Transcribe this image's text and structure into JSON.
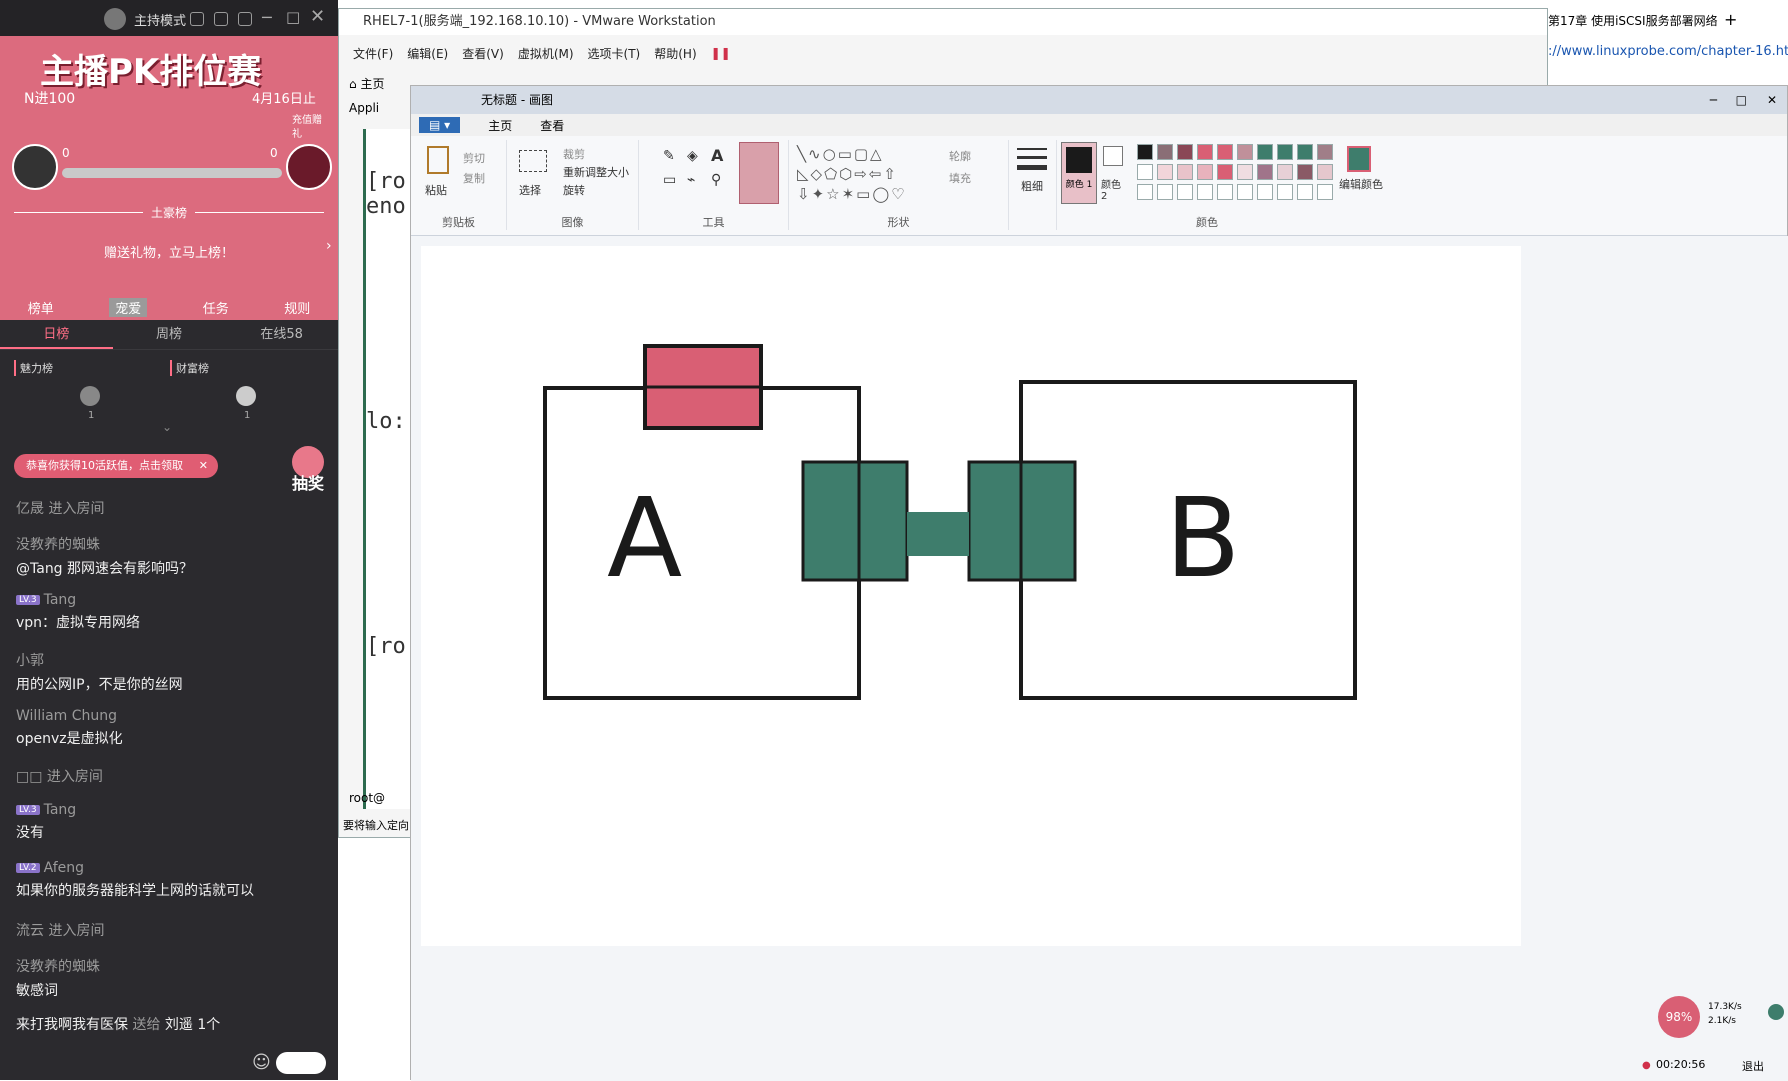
{
  "left_panel": {
    "header": {
      "mode_label": "主持模式"
    },
    "banner": {
      "title": "主播PK排位赛",
      "stage": "N进100",
      "deadline": "4月16日止",
      "score_left": "0",
      "score_right": "0",
      "section": "土豪榜",
      "prompt": "赠送礼物，立马上榜！",
      "side_badge": "充值赠礼"
    },
    "tabs": [
      "榜单",
      "宠爱",
      "任务",
      "规则"
    ],
    "rank_tabs": [
      "日榜",
      "周榜",
      "在线58"
    ],
    "boards": {
      "charm": "魅力榜",
      "wealth": "财富榜",
      "charm_count": "1",
      "wealth_count": "1"
    },
    "notice": "恭喜你获得10活跃值，点击领取",
    "lottery": "抽奖",
    "chat": [
      {
        "name": "亿晟",
        "text": "进入房间",
        "inline": true
      },
      {
        "name": "没教养的蜘蛛",
        "text": "@Tang 那网速会有影响吗？"
      },
      {
        "name": "Tang",
        "text": "vpn：虚拟专用网络",
        "badge": "LV.3"
      },
      {
        "name": "小郭",
        "text": "用的公网IP，不是你的丝网"
      },
      {
        "name": "William Chung",
        "text": "openvz是虚拟化"
      },
      {
        "name": "□□",
        "text": "进入房间",
        "inline": true
      },
      {
        "name": "Tang",
        "text": "没有",
        "badge": "LV.3"
      },
      {
        "name": "Afeng",
        "text": "如果你的服务器能科学上网的话就可以",
        "badge": "LV.2"
      },
      {
        "name": "流云",
        "text": "进入房间",
        "inline": true
      },
      {
        "name": "没教养的蜘蛛",
        "text": "敏感词"
      }
    ],
    "gift_line": {
      "sender": "来打我啊我有医保",
      "verb": "送给",
      "receiver": "刘遥",
      "count": "1个"
    }
  },
  "vmware": {
    "title": "RHEL7-1(服务端_192.168.10.10) - VMware Workstation",
    "menu": [
      "文件(F)",
      "编辑(E)",
      "查看(V)",
      "虚拟机(M)",
      "选项卡(T)",
      "帮助(H)"
    ],
    "tab_home": "主页",
    "tab_app": "Appli",
    "term_lines": [
      "[ro",
      "eno",
      "lo:",
      "[ro"
    ],
    "taskbar": "root@",
    "status": "要将输入定向"
  },
  "paint": {
    "title": "无标题 - 画图",
    "tab_file": "▤ ▾",
    "tabs": [
      "主页",
      "查看"
    ],
    "groups": {
      "clipboard": {
        "label": "剪贴板",
        "paste": "粘贴",
        "cut": "剪切",
        "copy": "复制"
      },
      "image": {
        "label": "图像",
        "select": "选择",
        "crop": "裁剪",
        "resize": "重新调整大小",
        "rotate": "旋转"
      },
      "tools": {
        "label": "工具"
      },
      "shapes": {
        "label": "形状",
        "outline": "轮廓",
        "fill": "填充"
      },
      "size": {
        "label": "粗细"
      },
      "colors": {
        "label": "颜色",
        "color1": "颜色 1",
        "color2": "颜色 2",
        "edit": "编辑颜色"
      }
    },
    "drawing": {
      "label_a": "A",
      "label_b": "B"
    },
    "colors": {
      "pink": "#d95f74",
      "teal": "#3e7d6c",
      "black": "#1a1a1a"
    }
  },
  "browser": {
    "tab_title": "第17章 使用iSCSI服务部署网络",
    "url": "://www.linuxprobe.com/chapter-16.htm"
  },
  "recorder": {
    "percent": "98%",
    "up": "17.3K/s",
    "down": "2.1K/s",
    "time": "00:20:56",
    "exit": "退出"
  }
}
